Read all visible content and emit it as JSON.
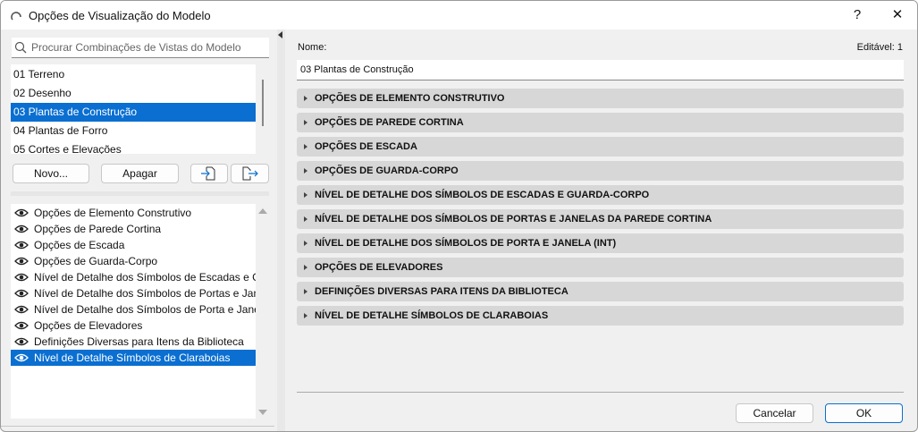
{
  "window": {
    "title": "Opções de Visualização do Modelo",
    "help": "?",
    "close": "✕"
  },
  "left": {
    "search_placeholder": "Procurar Combinações de Vistas do Modelo",
    "combinations": [
      "01 Terreno",
      "02 Desenho",
      "03 Plantas de Construção",
      "04 Plantas de Forro",
      "05 Cortes e Elevações"
    ],
    "selected_combination": 2,
    "new_label": "Novo...",
    "delete_label": "Apagar",
    "options": [
      "Opções de Elemento Construtivo",
      "Opções de Parede Cortina",
      "Opções de Escada",
      "Opções de Guarda-Corpo",
      "Nível de Detalhe dos Símbolos de Escadas e G...",
      "Nível de Detalhe dos Símbolos de Portas e Jan...",
      "Nível de Detalhe dos Símbolos de Porta e Jane...",
      "Opções de Elevadores",
      "Definições Diversas para Itens da Biblioteca",
      "Nível de Detalhe Símbolos de Claraboias"
    ],
    "selected_option": 9
  },
  "right": {
    "name_label": "Nome:",
    "editable_label": "Editável: 1",
    "name_value": "03 Plantas de Construção",
    "sections": [
      "OPÇÕES DE ELEMENTO CONSTRUTIVO",
      "OPÇÕES DE PAREDE CORTINA",
      "OPÇÕES DE ESCADA",
      "OPÇÕES DE GUARDA-CORPO",
      "NÍVEL DE DETALHE DOS SÍMBOLOS DE ESCADAS E GUARDA-CORPO",
      "NÍVEL DE DETALHE DOS SÍMBOLOS DE PORTAS E JANELAS DA PAREDE CORTINA",
      "NÍVEL DE DETALHE DOS SÍMBOLOS DE PORTA E JANELA (INT)",
      "OPÇÕES DE ELEVADORES",
      "DEFINIÇÕES DIVERSAS PARA ITENS DA BIBLIOTECA",
      "NÍVEL DE DETALHE SÍMBOLOS DE CLARABOIAS"
    ],
    "cancel_label": "Cancelar",
    "ok_label": "OK"
  },
  "colors": {
    "accent": "#0a6fd1",
    "section_bg": "#d7d7d7"
  }
}
